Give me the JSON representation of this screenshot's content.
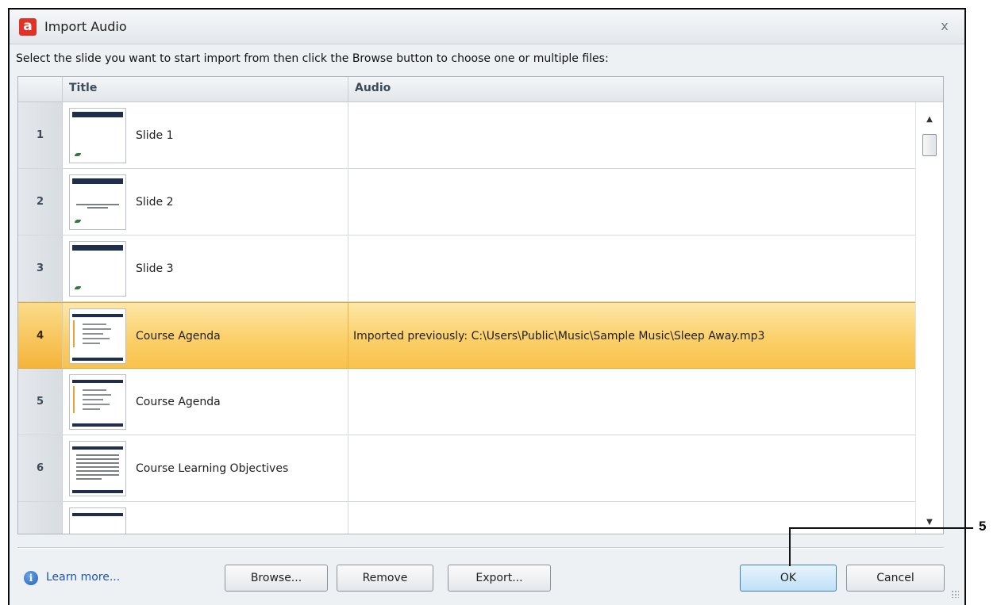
{
  "window": {
    "title": "Import Audio",
    "app_icon_glyph": "a",
    "close_glyph": "x"
  },
  "instruction": "Select the slide you want to start import from then click the Browse button to choose one or multiple files:",
  "grid": {
    "columns": {
      "title": "Title",
      "audio": "Audio"
    },
    "rows": [
      {
        "num": "1",
        "title": "Slide 1",
        "audio": ""
      },
      {
        "num": "2",
        "title": "Slide 2",
        "audio": ""
      },
      {
        "num": "3",
        "title": "Slide 3",
        "audio": ""
      },
      {
        "num": "4",
        "title": "Course Agenda",
        "audio": "Imported previously: C:\\Users\\Public\\Music\\Sample Music\\Sleep Away.mp3",
        "selected": true
      },
      {
        "num": "5",
        "title": "Course Agenda",
        "audio": ""
      },
      {
        "num": "6",
        "title": "Course Learning Objectives",
        "audio": ""
      },
      {
        "num": "",
        "title": "",
        "audio": ""
      }
    ]
  },
  "footer": {
    "learn_more": "Learn more...",
    "browse": "Browse...",
    "remove": "Remove",
    "export": "Export...",
    "ok": "OK",
    "cancel": "Cancel"
  },
  "callout": {
    "label": "5"
  },
  "colors": {
    "selection": "#f9c24b",
    "link": "#1b56b0",
    "app_icon": "#e03226"
  },
  "icons": {
    "app": "captivate-app-icon",
    "info": "info-icon",
    "close": "close-icon"
  }
}
